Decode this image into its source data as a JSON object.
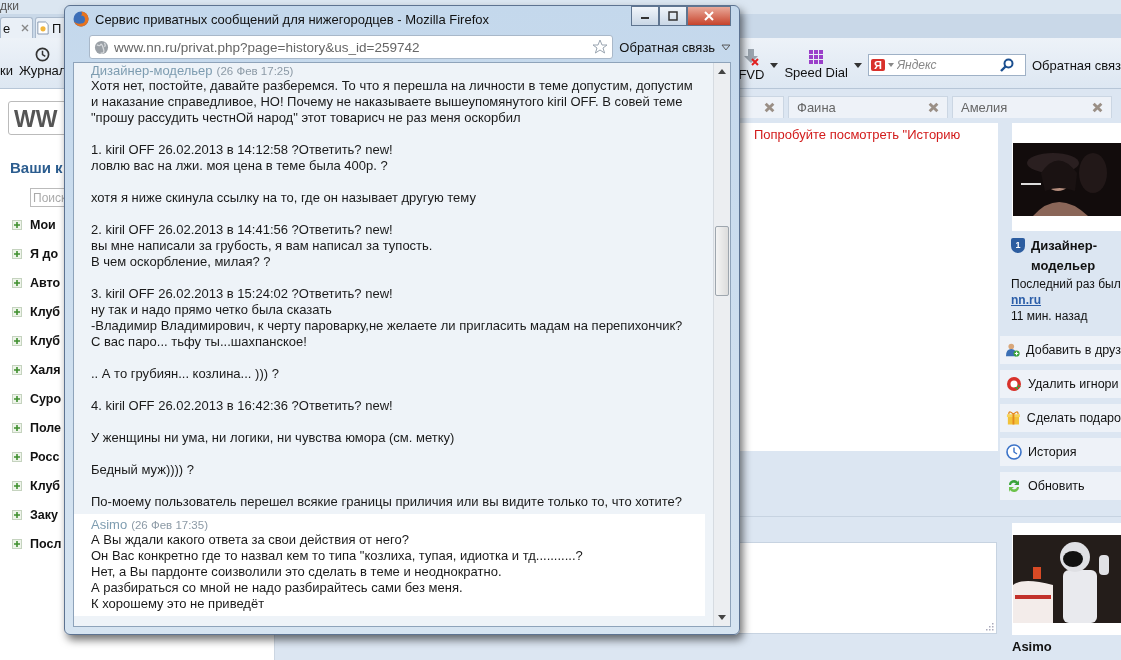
{
  "browser": {
    "menu": [
      "дки"
    ],
    "tabs": [
      {
        "kind": "plain",
        "label": "е"
      },
      {
        "kind": "page",
        "label": "П"
      }
    ],
    "toolbar": {
      "bookmarks_label": "ки",
      "history_label": "Журнал",
      "fvd_label": "FVD",
      "speed_dial_label": "Speed Dial",
      "search": {
        "engine_mark": "Я",
        "placeholder": "Яндекс"
      },
      "feedback": "Обратная связ"
    }
  },
  "sidebar": {
    "logo": "WW",
    "heading": "Ваши к",
    "search": {
      "placeholder": "Поиск"
    },
    "items": [
      "Мои",
      "Я до",
      "Авто",
      "Клуб",
      "Клуб",
      "Халя",
      "Суро",
      "Поле",
      "Росс",
      "Клуб",
      "Заку",
      "Посл"
    ]
  },
  "chat": {
    "tabs": [
      {
        "kind": "hidden"
      },
      {
        "kind": "named",
        "label": "Фаина"
      },
      {
        "kind": "named",
        "label": "Амелия"
      }
    ],
    "notice": "Попробуйте посмотреть \"Историю",
    "profile": {
      "rank": "1",
      "name": "Дизайнер-модельер",
      "last_seen": "Последний раз был",
      "site": "nn.ru",
      "ago": "11 мин. назад"
    },
    "actions": [
      {
        "kind": "add-friend",
        "label": "Добавить в друз"
      },
      {
        "kind": "unignore",
        "label": "Удалить игнори"
      },
      {
        "kind": "gift",
        "label": "Сделать подаро"
      },
      {
        "kind": "history",
        "label": "История"
      },
      {
        "kind": "refresh",
        "label": "Обновить"
      }
    ],
    "reply_user": "Asimo"
  },
  "popup": {
    "title": "Сервис приватных сообщений для нижегородцев - Mozilla Firefox",
    "url": "www.nn.ru/privat.php?page=history&us_id=259742",
    "feedback": "Обратная связь",
    "messages": [
      {
        "author": "Дизайнер-модельер",
        "date": "(26 Фев 17:25)",
        "paragraphs": [
          "Хотя нет, постойте, давайте разберемся. То что я перешла на личности в теме допустим, допустим и наказание справедливое, НО! Почему не наказываете вышеупомянутого kiril OFF. В совей теме \"прошу рассудить честнОй народ\" этот товарисч не раз меня оскорбил",
          "1. kiril OFF 26.02.2013 в 14:12:58 ?Ответить? new!\nловлю вас на лжи. моя цена в теме была 400р. ?",
          "хотя я ниже скинула ссылку на то, где он называет другую тему",
          "2. kiril OFF 26.02.2013 в 14:41:56 ?Ответить? new!\nвы мне написали за грубость, я вам написал за тупость.\nВ чем оскорбление, милая? ?",
          "3. kiril OFF 26.02.2013 в 15:24:02 ?Ответить? new!\nну так и надо прямо четко была сказать\n-Владимир Владимирович, к черту пароварку,не желаете ли пригласить мадам на перепихончик? С вас паро... тьфу ты...шахпанское!",
          ".. А то грубиян... козлина... ))) ?",
          "4. kiril OFF 26.02.2013 в 16:42:36 ?Ответить? new!",
          "У женщины ни ума, ни логики, ни чувства юмора (см. метку)",
          "Бедный муж)))) ?",
          "По-моему пользователь перешел всякие границы приличия или вы видите только то, что хотите?"
        ]
      },
      {
        "author": "Asimo",
        "date": "(26 Фев 17:35)",
        "paragraphs": [
          "А Вы ждали какого ответа за свои действия от него?\nОн Вас конкретно где то назвал кем то типа \"козлиха, тупая, идиотка и тд...........?\nНет, а Вы пардонте соизволили это сделать в теме и неоднократно.\nА разбираться со мной не надо разбирайтесь сами без меня.\nК хорошему это не приведёт"
        ]
      }
    ]
  }
}
